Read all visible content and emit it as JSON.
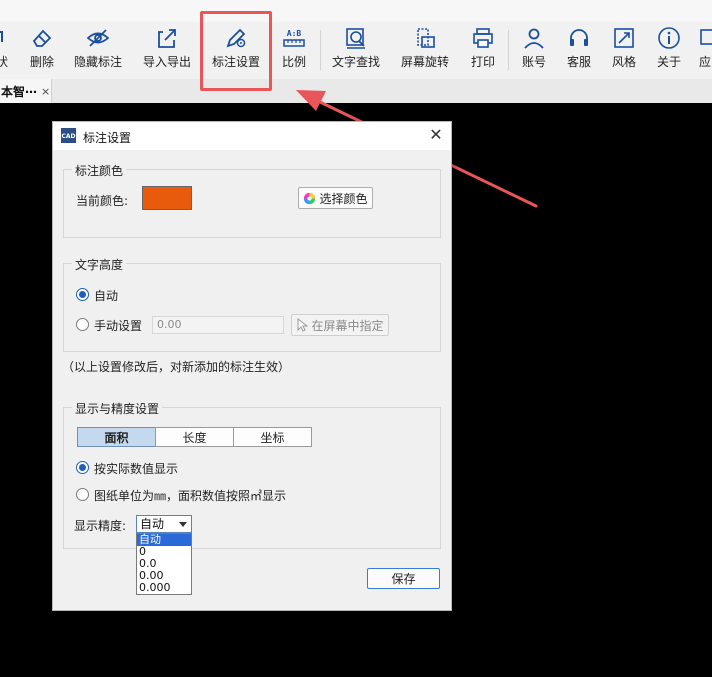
{
  "toolbar": {
    "items": [
      {
        "label": "状",
        "icon": "shape-icon"
      },
      {
        "label": "删除",
        "icon": "eraser-icon"
      },
      {
        "label": "隐藏标注",
        "icon": "eye-off-icon"
      },
      {
        "label": "导入导出",
        "icon": "import-export-icon"
      },
      {
        "label": "标注设置",
        "icon": "annotation-settings-icon"
      },
      {
        "label": "比例",
        "icon": "scale-ruler-icon",
        "glyph": "A:B"
      },
      {
        "label": "文字查找",
        "icon": "text-search-icon"
      },
      {
        "label": "屏幕旋转",
        "icon": "screen-rotate-icon"
      },
      {
        "label": "打印",
        "icon": "printer-icon"
      },
      {
        "label": "账号",
        "icon": "account-icon"
      },
      {
        "label": "客服",
        "icon": "headset-icon"
      },
      {
        "label": "风格",
        "icon": "style-icon"
      },
      {
        "label": "关于",
        "icon": "info-icon"
      },
      {
        "label": "应",
        "icon": "app-icon"
      }
    ]
  },
  "tab": {
    "title": "本智⋯",
    "close": "×"
  },
  "dialog": {
    "title": "标注设置",
    "app_icon_text": "CAD",
    "close": "✕",
    "color_group": {
      "legend": "标注颜色",
      "current_label": "当前颜色:",
      "current_color": "#e85a0c",
      "choose_button": "选择颜色"
    },
    "height_group": {
      "legend": "文字高度",
      "auto_label": "自动",
      "manual_label": "手动设置",
      "manual_value": "0.00",
      "pick_button": "在屏幕中指定"
    },
    "note": "（以上设置修改后，对新添加的标注生效）",
    "precision_group": {
      "legend": "显示与精度设置",
      "tabs": [
        "面积",
        "长度",
        "坐标"
      ],
      "active_tab": "面积",
      "option_actual": "按实际数值显示",
      "option_mm": "图纸单位为㎜，面积数值按照㎡显示",
      "precision_label": "显示精度:",
      "precision_value": "自动",
      "precision_options": [
        "自动",
        "0",
        "0.0",
        "0.00",
        "0.000"
      ]
    },
    "save_button": "保存"
  },
  "colors": {
    "highlight": "#e8565a",
    "accent": "#1f5fb8",
    "selected": "#2a6ad6"
  }
}
